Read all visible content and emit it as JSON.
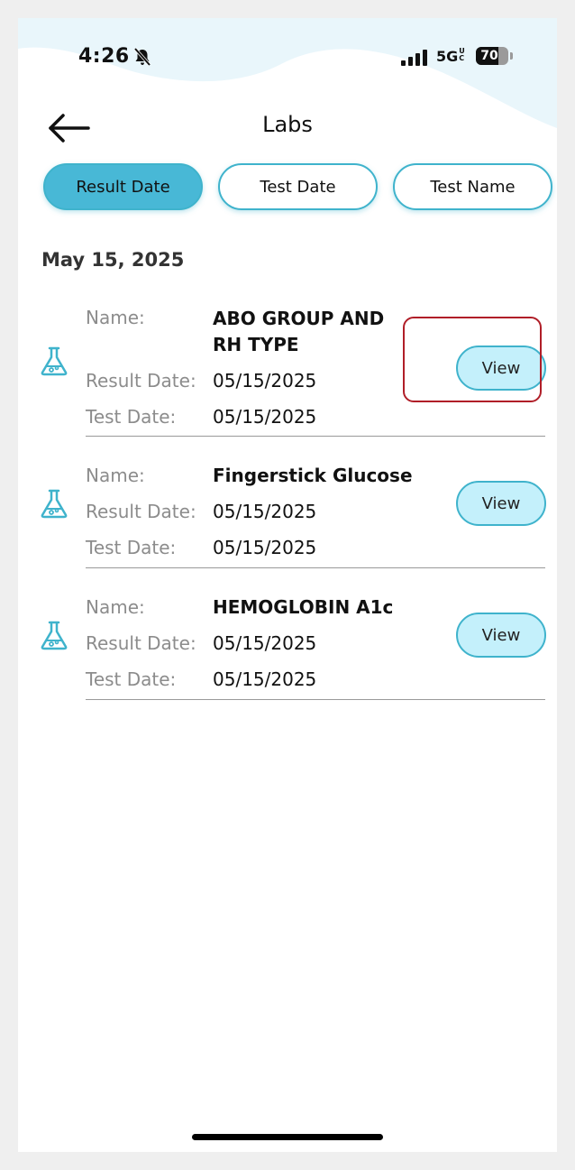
{
  "status_bar": {
    "time": "4:26",
    "network": "5G",
    "network_suffix": "UC",
    "battery": "70",
    "battery_level": 0.7
  },
  "header": {
    "title": "Labs"
  },
  "sort_tabs": [
    {
      "label": "Result Date",
      "active": true
    },
    {
      "label": "Test Date",
      "active": false
    },
    {
      "label": "Test Name",
      "active": false
    }
  ],
  "group": {
    "date": "May 15, 2025"
  },
  "field_labels": {
    "name": "Name:",
    "result_date": "Result Date:",
    "test_date": "Test Date:"
  },
  "labs": [
    {
      "name_line1": "ABO GROUP AND",
      "name_line2": "RH TYPE",
      "result_date": "05/15/2025",
      "test_date": "05/15/2025",
      "button": "View"
    },
    {
      "name_line1": "Fingerstick Glucose",
      "result_date": "05/15/2025",
      "test_date": "05/15/2025",
      "button": "View"
    },
    {
      "name_line1": "HEMOGLOBIN A1c",
      "result_date": "05/15/2025",
      "test_date": "05/15/2025",
      "button": "View"
    }
  ],
  "colors": {
    "accent": "#48b8d6",
    "button_fill": "#c4f0fb",
    "highlight": "#b01e28",
    "wave": "#e9f6fb"
  }
}
